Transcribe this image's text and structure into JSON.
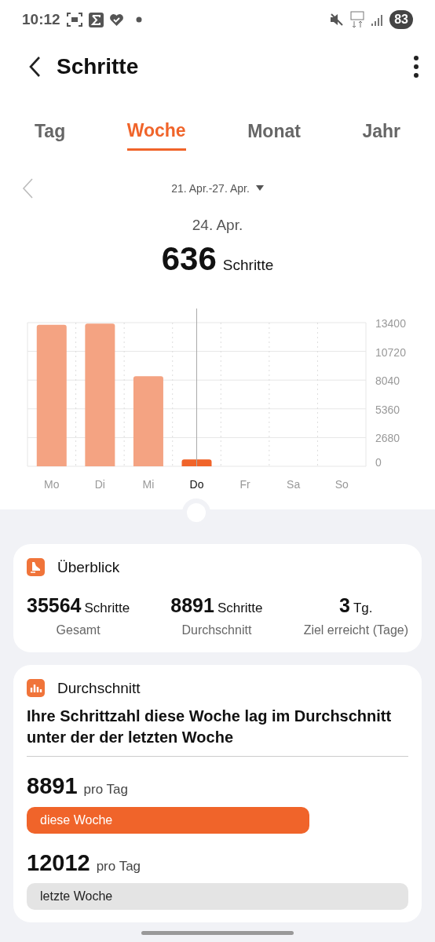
{
  "status_bar": {
    "time": "10:12",
    "battery": "83"
  },
  "header": {
    "title": "Schritte"
  },
  "tabs": [
    {
      "label": "Tag",
      "selected": false
    },
    {
      "label": "Woche",
      "selected": true
    },
    {
      "label": "Monat",
      "selected": false
    },
    {
      "label": "Jahr",
      "selected": false
    }
  ],
  "period": {
    "range": "21. Apr.-27. Apr.",
    "date": "24. Apr.",
    "value": "636",
    "unit": "Schritte"
  },
  "chart": {
    "chart_data": {
      "type": "bar",
      "categories": [
        "Mo",
        "Di",
        "Mi",
        "Do",
        "Fr",
        "Sa",
        "So"
      ],
      "values": [
        13200,
        13300,
        8400,
        636,
        null,
        null,
        null
      ],
      "ylim": [
        0,
        13400
      ],
      "yticks": [
        0,
        2680,
        5360,
        8040,
        10720,
        13400
      ],
      "grid": true
    },
    "days": [
      {
        "selected": false
      },
      {
        "selected": false
      },
      {
        "selected": false
      },
      {
        "selected": true
      },
      {
        "selected": false
      },
      {
        "selected": false
      },
      {
        "selected": false
      }
    ]
  },
  "overview": {
    "title": "Überblick",
    "stats": [
      {
        "value": "35564",
        "unit": "Schritte",
        "label": "Gesamt"
      },
      {
        "value": "8891",
        "unit": "Schritte",
        "label": "Durchschnitt"
      },
      {
        "value": "3",
        "unit": "Tg.",
        "label": "Ziel erreicht (Tage)"
      }
    ]
  },
  "average": {
    "title": "Durchschnitt",
    "message": "Ihre Schrittzahl diese Woche lag im Durchschnitt unter der der letzten Woche",
    "weeks": [
      {
        "value": "8891",
        "unit": "pro Tag",
        "label": "diese Woche",
        "current": true
      },
      {
        "value": "12012",
        "unit": "pro Tag",
        "label": "letzte Woche",
        "current": false
      }
    ]
  }
}
